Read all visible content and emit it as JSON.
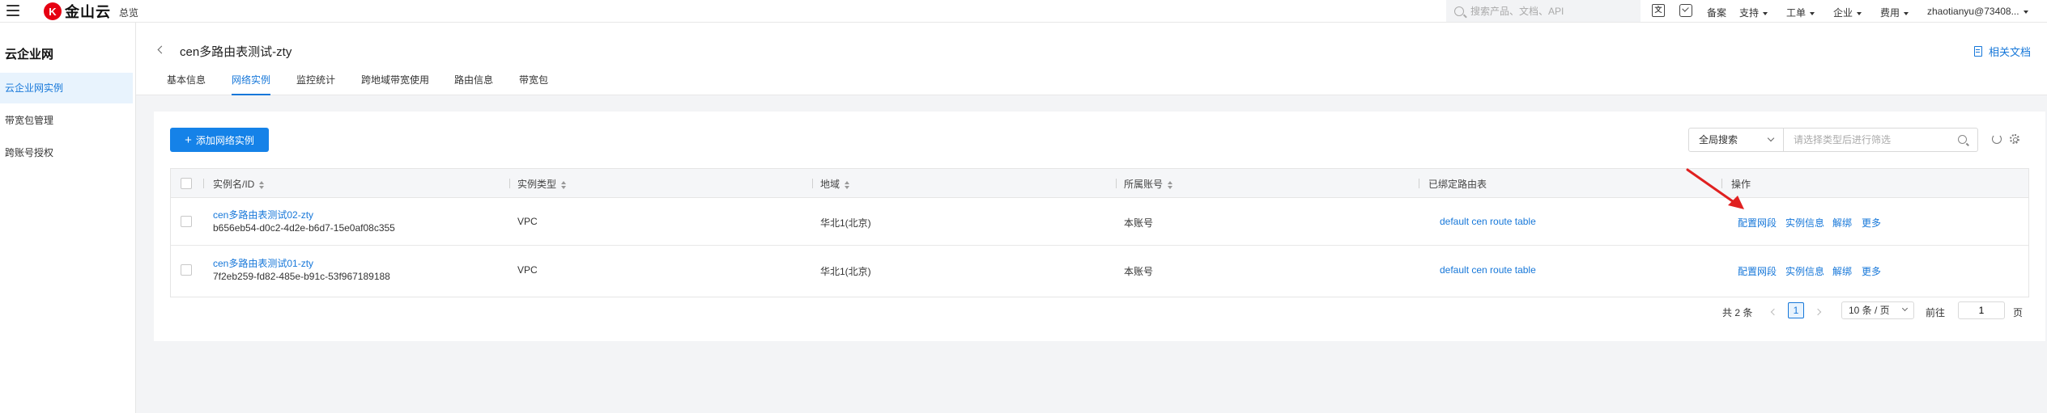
{
  "topbar": {
    "logo_mark": "K",
    "logo_text": "金山云",
    "overview": "总览",
    "search_placeholder": "搜索产品、文档、API",
    "translate_glyph": "文",
    "links": {
      "filing": "备案",
      "support": "支持",
      "ticket": "工单",
      "enterprise": "企业",
      "billing": "费用",
      "user": "zhaotianyu@73408..."
    }
  },
  "sidebar": {
    "title": "云企业网",
    "items": [
      {
        "label": "云企业网实例",
        "active": true
      },
      {
        "label": "带宽包管理",
        "active": false
      },
      {
        "label": "跨账号授权",
        "active": false
      }
    ]
  },
  "header": {
    "title": "cen多路由表测试-zty",
    "doc_link": "相关文档",
    "tabs": [
      {
        "label": "基本信息"
      },
      {
        "label": "网络实例",
        "active": true
      },
      {
        "label": "监控统计"
      },
      {
        "label": "跨地域带宽使用"
      },
      {
        "label": "路由信息"
      },
      {
        "label": "带宽包"
      }
    ]
  },
  "toolbar": {
    "add_label": "添加网络实例",
    "scope_select": "全局搜索",
    "filter_placeholder": "请选择类型后进行筛选"
  },
  "table": {
    "columns": [
      "实例名/ID",
      "实例类型",
      "地域",
      "所属账号",
      "已绑定路由表",
      "操作"
    ],
    "rows": [
      {
        "name": "cen多路由表测试02-zty",
        "id": "b656eb54-d0c2-4d2e-b6d7-15e0af08c355",
        "type": "VPC",
        "region": "华北1(北京)",
        "account": "本账号",
        "route_table": "default cen route table",
        "ops": [
          "配置网段",
          "实例信息",
          "解绑",
          "更多"
        ]
      },
      {
        "name": "cen多路由表测试01-zty",
        "id": "7f2eb259-fd82-485e-b91c-53f967189188",
        "type": "VPC",
        "region": "华北1(北京)",
        "account": "本账号",
        "route_table": "default cen route table",
        "ops": [
          "配置网段",
          "实例信息",
          "解绑",
          "更多"
        ]
      }
    ]
  },
  "pagination": {
    "total": "共 2 条",
    "current_page": "1",
    "page_size": "10 条 / 页",
    "goto_label": "前往",
    "goto_value": "1",
    "page_label": "页"
  },
  "colors": {
    "accent": "#1677d9",
    "button": "#1582e8",
    "annotation_arrow": "#e02020"
  }
}
